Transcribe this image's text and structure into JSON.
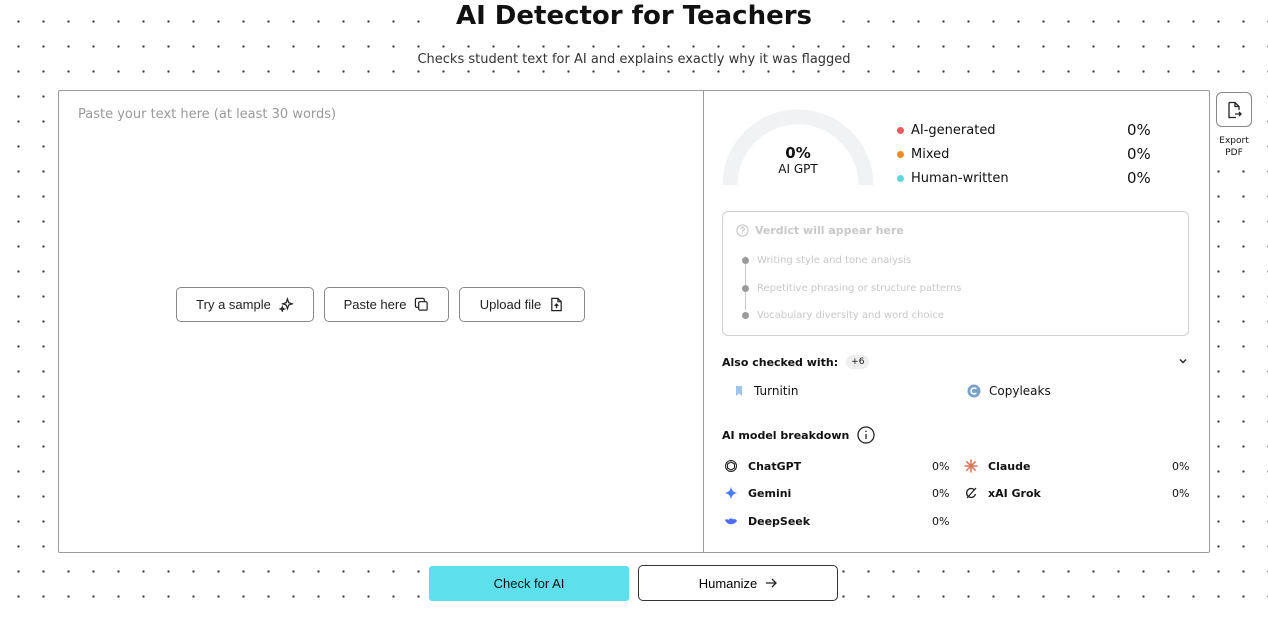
{
  "header": {
    "title": "AI Detector for Teachers",
    "subtitle": "Checks student text for AI and explains exactly why it was flagged"
  },
  "input": {
    "placeholder": "Paste your text here (at least 30 words)",
    "actions": {
      "sample_label": "Try a sample",
      "paste_label": "Paste here",
      "upload_label": "Upload file"
    }
  },
  "gauge": {
    "percent": "0%",
    "label": "AI GPT"
  },
  "legend": [
    {
      "name": "AI-generated",
      "value": "0%",
      "color": "#f05a5a"
    },
    {
      "name": "Mixed",
      "value": "0%",
      "color": "#f08a24"
    },
    {
      "name": "Human-written",
      "value": "0%",
      "color": "#5ed8e0"
    }
  ],
  "verdict": {
    "title": "Verdict will appear here",
    "items": [
      "Writing style and tone analysis",
      "Repetitive phrasing or structure patterns",
      "Vocabulary diversity and word choice"
    ]
  },
  "also_checked": {
    "label": "Also checked with:",
    "badge": "+6",
    "checkers": [
      "Turnitin",
      "Copyleaks"
    ]
  },
  "breakdown": {
    "title": "AI model breakdown",
    "models": [
      {
        "name": "ChatGPT",
        "value": "0%",
        "icon": "chatgpt-icon"
      },
      {
        "name": "Claude",
        "value": "0%",
        "icon": "claude-icon"
      },
      {
        "name": "Gemini",
        "value": "0%",
        "icon": "gemini-icon"
      },
      {
        "name": "xAI Grok",
        "value": "0%",
        "icon": "grok-icon"
      },
      {
        "name": "DeepSeek",
        "value": "0%",
        "icon": "deepseek-icon"
      }
    ]
  },
  "export": {
    "label": "Export PDF"
  },
  "footer": {
    "check_label": "Check for AI",
    "humanize_label": "Humanize"
  }
}
